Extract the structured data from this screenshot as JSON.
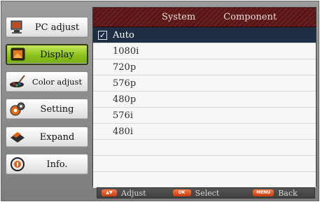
{
  "menu": {
    "items": [
      {
        "label": "PC adjust",
        "icon": "pc-adjust-icon"
      },
      {
        "label": "Display",
        "icon": "display-icon",
        "selected": true
      },
      {
        "label": "Color adjust",
        "icon": "color-adjust-icon"
      },
      {
        "label": "Setting",
        "icon": "setting-icon"
      },
      {
        "label": "Expand",
        "icon": "expand-icon"
      },
      {
        "label": "Info.",
        "icon": "info-icon"
      }
    ]
  },
  "panel": {
    "header_left": "System",
    "header_right": "Component",
    "options": [
      {
        "label": "Auto",
        "selected": true,
        "checkmark": "✓"
      },
      {
        "label": "1080i"
      },
      {
        "label": "720p"
      },
      {
        "label": "576p"
      },
      {
        "label": "480p"
      },
      {
        "label": "576i"
      },
      {
        "label": "480i"
      }
    ]
  },
  "footer": {
    "adjust_label": "Adjust",
    "select_label": "Select",
    "back_label": "Back",
    "adjust_key": "▲▼",
    "select_key": "OK",
    "back_key": "MENU"
  },
  "colors": {
    "selected_menu": "#8bc21c",
    "header_bg": "#5b1414",
    "selected_row": "#1e2e45"
  }
}
